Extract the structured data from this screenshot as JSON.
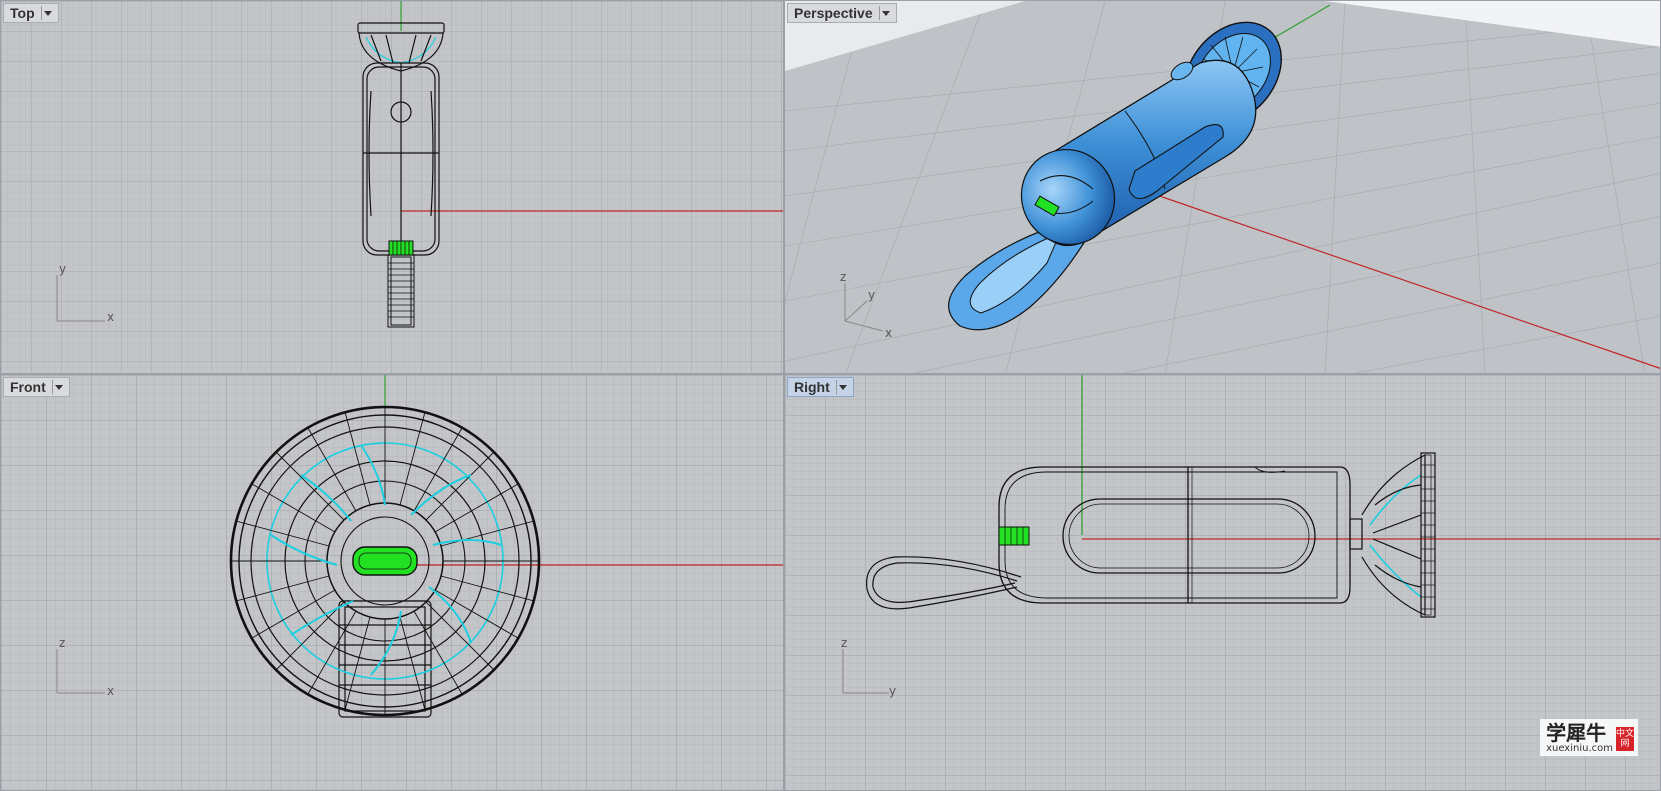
{
  "viewports": {
    "top": {
      "label": "Top",
      "axes": {
        "h": "x",
        "v": "y"
      }
    },
    "perspective": {
      "label": "Perspective",
      "axes": {
        "a": "z",
        "b": "y",
        "c": "x"
      }
    },
    "front": {
      "label": "Front",
      "axes": {
        "h": "x",
        "v": "z"
      }
    },
    "right": {
      "label": "Right",
      "axes": {
        "h": "y",
        "v": "z"
      }
    }
  },
  "active_viewport": "Right",
  "watermark": {
    "chinese": "学犀牛",
    "url": "xuexiniu.com",
    "badge": "中文网"
  },
  "colors": {
    "viewport_bg": "#c3c5c8",
    "grid_minor": "#b3b6ba",
    "grid_major": "#9c9fa5",
    "x_axis": "#c0272d",
    "y_axis": "#2fa02f",
    "highlight_green": "#22e022",
    "cyan": "#22d6e6",
    "shaded_blue": "#3d8fd6"
  }
}
